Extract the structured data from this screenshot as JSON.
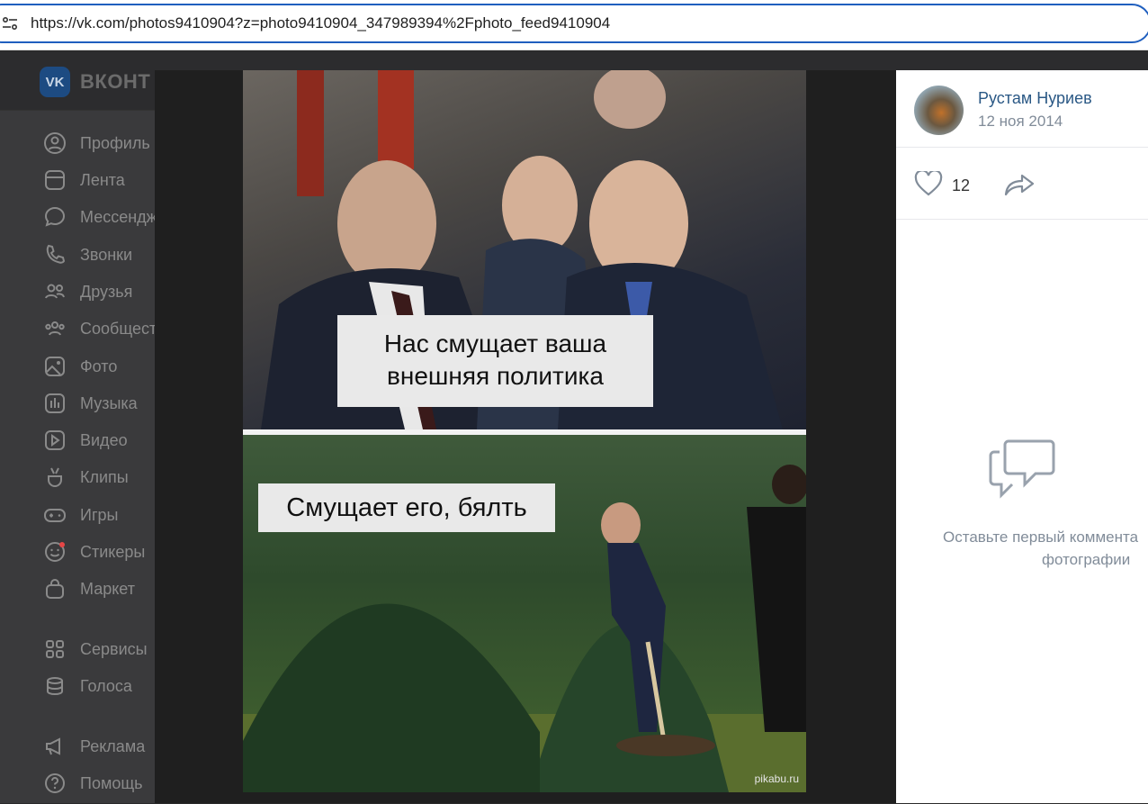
{
  "browser": {
    "url": "https://vk.com/photos9410904?z=photo9410904_347989394%2Fphoto_feed9410904",
    "site_info_icon": "tune-icon"
  },
  "vk": {
    "brand": "ВКОНТ",
    "logo_text": "VK"
  },
  "sidebar": {
    "items": [
      {
        "label": "Профиль",
        "icon": "user-circle-icon"
      },
      {
        "label": "Лента",
        "icon": "news-feed-icon"
      },
      {
        "label": "Мессендж",
        "icon": "message-icon"
      },
      {
        "label": "Звонки",
        "icon": "phone-icon"
      },
      {
        "label": "Друзья",
        "icon": "friends-icon"
      },
      {
        "label": "Сообщест",
        "icon": "communities-icon"
      },
      {
        "label": "Фото",
        "icon": "photo-icon"
      },
      {
        "label": "Музыка",
        "icon": "music-icon"
      },
      {
        "label": "Видео",
        "icon": "video-icon"
      },
      {
        "label": "Клипы",
        "icon": "clips-icon"
      },
      {
        "label": "Игры",
        "icon": "gamepad-icon"
      },
      {
        "label": "Стикеры",
        "icon": "sticker-icon"
      },
      {
        "label": "Маркет",
        "icon": "market-bag-icon"
      },
      {
        "label": "Сервисы",
        "icon": "services-grid-icon"
      },
      {
        "label": "Голоса",
        "icon": "votes-icon"
      },
      {
        "label": "Реклама",
        "icon": "ads-megaphone-icon"
      },
      {
        "label": "Помощь",
        "icon": "help-icon"
      }
    ]
  },
  "photo": {
    "caption_top_line1": "Нас смущает ваша",
    "caption_top_line2": "внешняя политика",
    "caption_bottom": "Смущает его, бялть",
    "watermark": "pikabu.ru"
  },
  "info_panel": {
    "author": "Рустам Нуриев",
    "date": "12 ноя 2014",
    "likes": "12",
    "empty_comments_line1": "Оставьте первый коммента",
    "empty_comments_line2": "фотографии"
  },
  "colors": {
    "link": "#2a5885",
    "muted": "#818c99",
    "address_border": "#1f5fbf"
  }
}
